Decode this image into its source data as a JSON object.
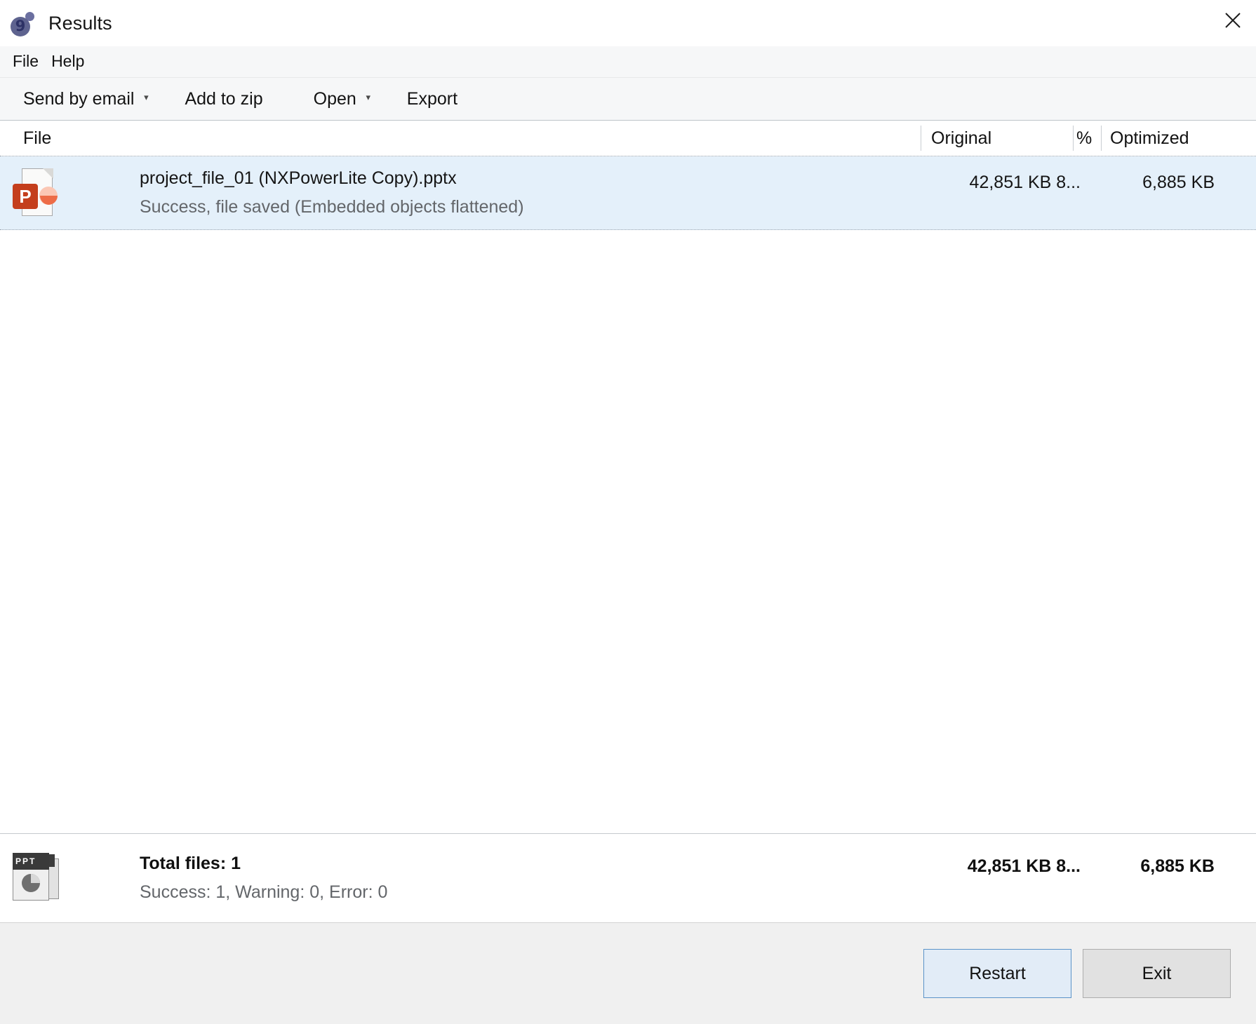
{
  "window": {
    "title": "Results",
    "logo_icon": "nxpowerlite-logo-icon",
    "logo_glyph": "9",
    "close_icon": "close-icon"
  },
  "menubar": {
    "items": [
      {
        "label": "File"
      },
      {
        "label": "Help"
      }
    ]
  },
  "toolbar": {
    "send_by_email": "Send by email",
    "dropdown_glyph": "▾",
    "add_to_zip": "Add to zip",
    "open": "Open",
    "export": "Export"
  },
  "table": {
    "columns": {
      "file": "File",
      "original": "Original",
      "percent": "%",
      "optimized": "Optimized"
    },
    "rows": [
      {
        "icon": "powerpoint-file-icon",
        "icon_letter": "P",
        "filename": "project_file_01 (NXPowerLite Copy).pptx",
        "status": "Success, file saved (Embedded objects flattened)",
        "original": "42,851 KB 8...",
        "optimized": "6,885 KB",
        "selected": true
      }
    ]
  },
  "summary": {
    "icon": "powerpoint-stack-icon",
    "icon_label": "PPT",
    "total_files": "Total files: 1",
    "detail": "Success: 1, Warning: 0, Error: 0",
    "original": "42,851 KB 8...",
    "optimized": "6,885 KB"
  },
  "footer": {
    "restart_label": "Restart",
    "exit_label": "Exit"
  },
  "colors": {
    "selection_row": "#e4f0fa",
    "toolbar_bg": "#f6f7f8",
    "footer_bg": "#f0f0f0",
    "primary_button_border": "#5b93c8",
    "powerpoint_orange": "#c43e1c",
    "logo_purple": "#5e638f"
  }
}
